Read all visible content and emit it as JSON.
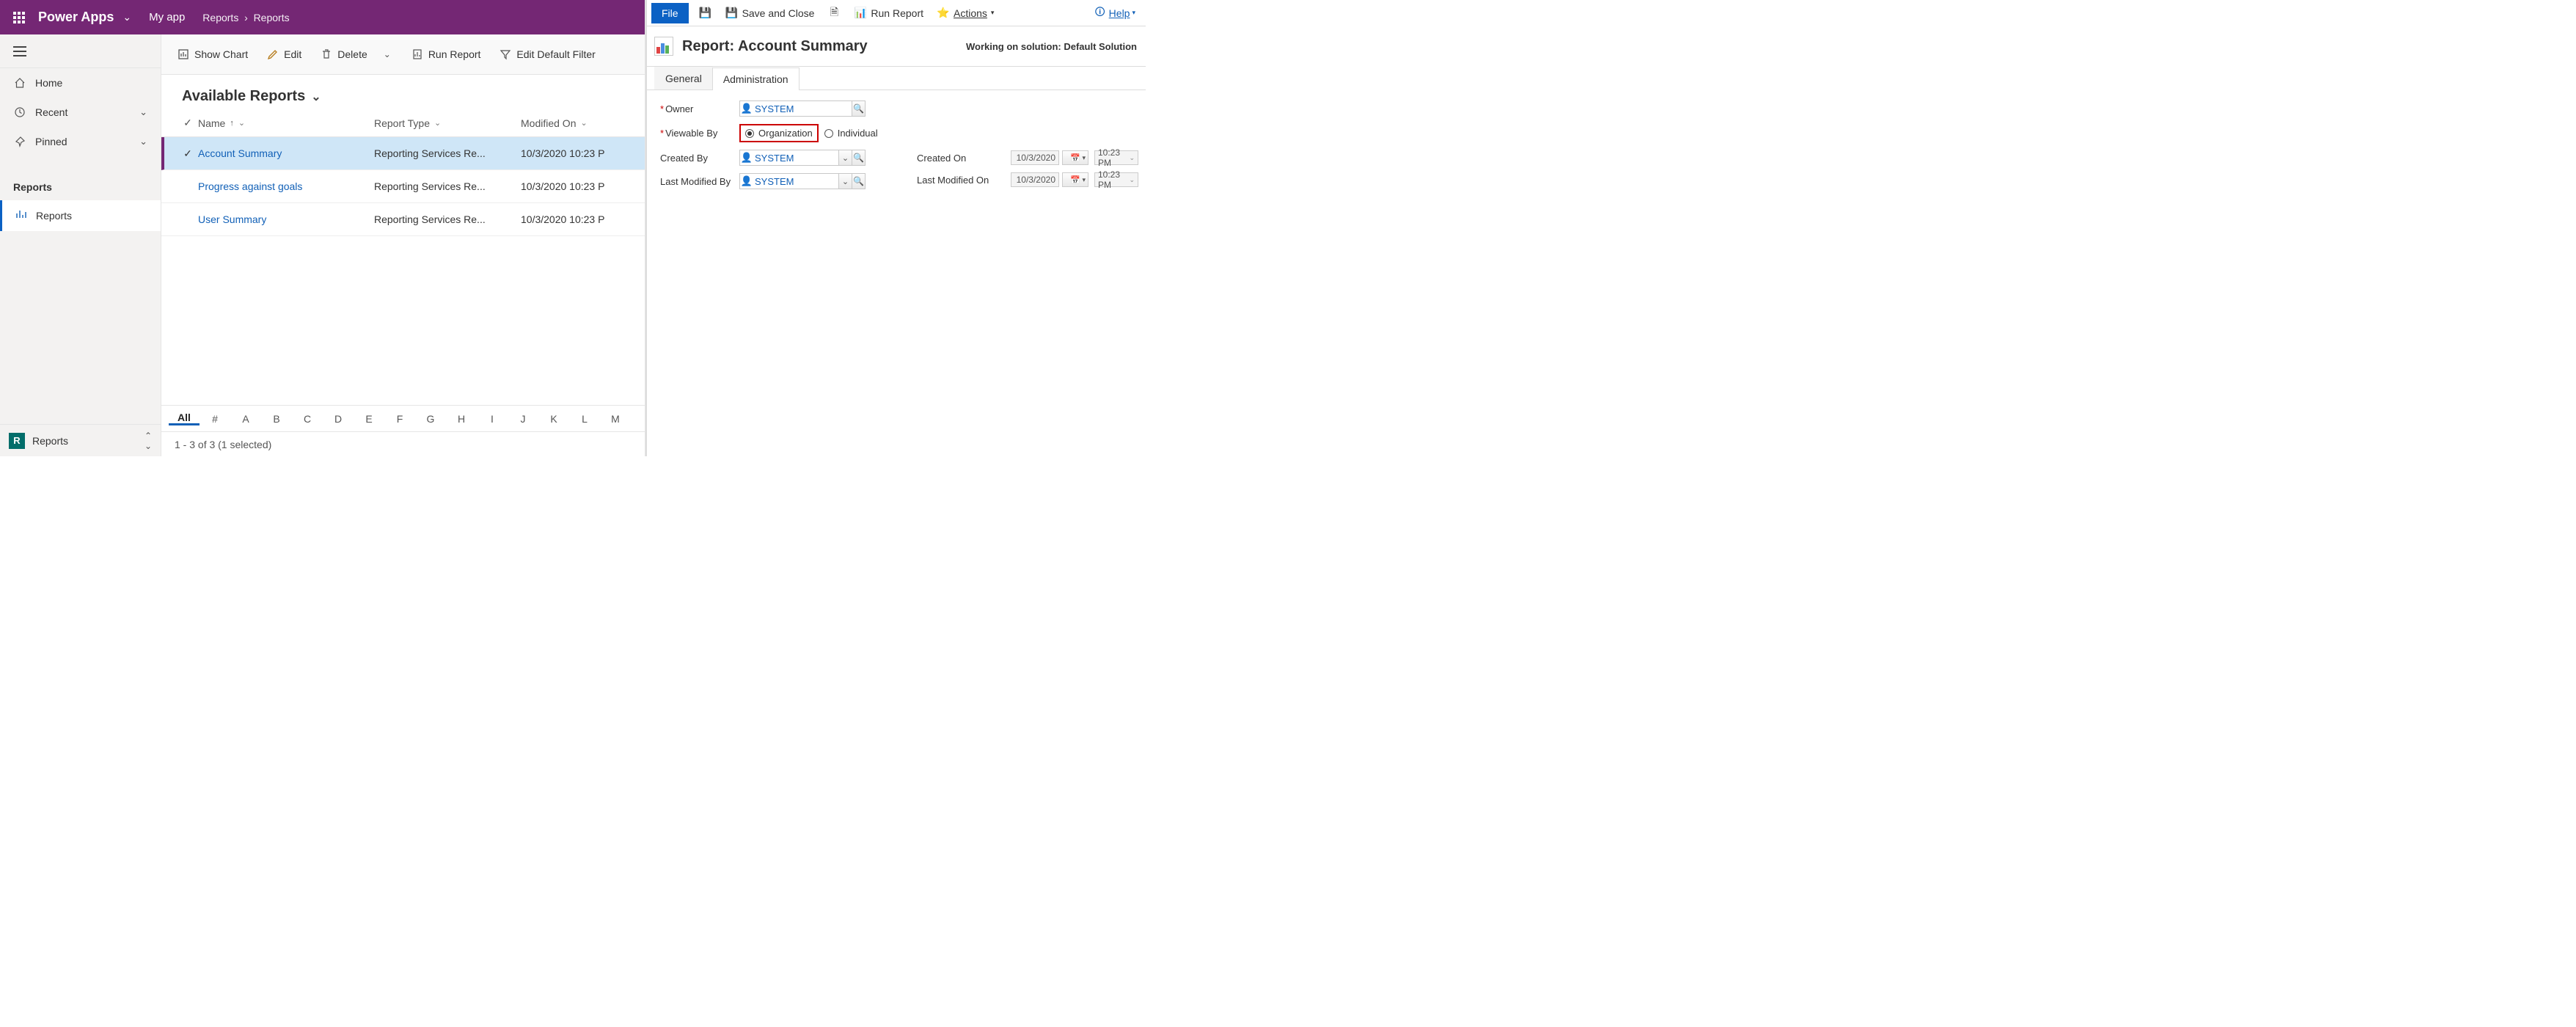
{
  "header": {
    "brand": "Power Apps",
    "app_name": "My app",
    "breadcrumb": [
      "Reports",
      "Reports"
    ]
  },
  "sidebar": {
    "items": [
      {
        "icon": "home",
        "label": "Home",
        "chev": false
      },
      {
        "icon": "recent",
        "label": "Recent",
        "chev": true
      },
      {
        "icon": "pin",
        "label": "Pinned",
        "chev": true
      }
    ],
    "group_title": "Reports",
    "sub_item": "Reports",
    "bottom_env_letter": "R",
    "bottom_label": "Reports"
  },
  "toolbar": {
    "show_chart": "Show Chart",
    "edit": "Edit",
    "delete": "Delete",
    "run_report": "Run Report",
    "edit_filter": "Edit Default Filter"
  },
  "view": {
    "title": "Available Reports"
  },
  "grid": {
    "columns": {
      "name": "Name",
      "type": "Report Type",
      "modified": "Modified On"
    },
    "rows": [
      {
        "selected": true,
        "name": "Account Summary",
        "type": "Reporting Services Re...",
        "modified": "10/3/2020 10:23 P"
      },
      {
        "selected": false,
        "name": "Progress against goals",
        "type": "Reporting Services Re...",
        "modified": "10/3/2020 10:23 P"
      },
      {
        "selected": false,
        "name": "User Summary",
        "type": "Reporting Services Re...",
        "modified": "10/3/2020 10:23 P"
      }
    ],
    "alpha": [
      "All",
      "#",
      "A",
      "B",
      "C",
      "D",
      "E",
      "F",
      "G",
      "H",
      "I",
      "J",
      "K",
      "L",
      "M"
    ],
    "status": "1 - 3 of 3 (1 selected)"
  },
  "editor": {
    "file_tab": "File",
    "tb": {
      "save_close": "Save and Close",
      "run_report": "Run Report",
      "actions": "Actions"
    },
    "help_label": "Help",
    "title_prefix": "Report:",
    "title_name": "Account Summary",
    "solution_text": "Working on solution: Default Solution",
    "tabs": {
      "general": "General",
      "admin": "Administration"
    },
    "fields": {
      "owner_label": "Owner",
      "owner_value": "SYSTEM",
      "viewable_label": "Viewable By",
      "viewable_org": "Organization",
      "viewable_ind": "Individual",
      "created_by_label": "Created By",
      "created_by_value": "SYSTEM",
      "last_mod_by_label": "Last Modified By",
      "last_mod_by_value": "SYSTEM",
      "created_on_label": "Created On",
      "created_on_date": "10/3/2020",
      "created_on_time": "10:23 PM",
      "last_mod_on_label": "Last Modified On",
      "last_mod_on_date": "10/3/2020",
      "last_mod_on_time": "10:23 PM"
    }
  }
}
